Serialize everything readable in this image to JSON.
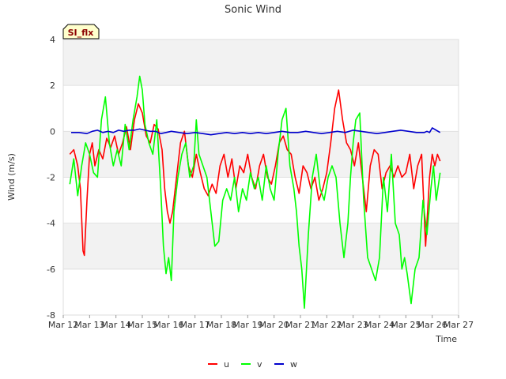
{
  "chart_data": {
    "type": "line",
    "title": "Sonic Wind",
    "xlabel": "Time",
    "ylabel": "Wind (m/s)",
    "badge": "SI_flx",
    "ylim": [
      -8,
      4
    ],
    "yticks": [
      -8,
      -6,
      -4,
      -2,
      0,
      2,
      4
    ],
    "xlim": [
      12,
      27
    ],
    "xticks": [
      {
        "x": 12,
        "label": "Mar 12"
      },
      {
        "x": 13,
        "label": "Mar 13"
      },
      {
        "x": 14,
        "label": "Mar 14"
      },
      {
        "x": 15,
        "label": "Mar 15"
      },
      {
        "x": 16,
        "label": "Mar 16"
      },
      {
        "x": 17,
        "label": "Mar 17"
      },
      {
        "x": 18,
        "label": "Mar 18"
      },
      {
        "x": 19,
        "label": "Mar 19"
      },
      {
        "x": 20,
        "label": "Mar 20"
      },
      {
        "x": 21,
        "label": "Mar 21"
      },
      {
        "x": 22,
        "label": "Mar 22"
      },
      {
        "x": 23,
        "label": "Mar 23"
      },
      {
        "x": 24,
        "label": "Mar 24"
      },
      {
        "x": 25,
        "label": "Mar 25"
      },
      {
        "x": 26,
        "label": "Mar 26"
      },
      {
        "x": 27,
        "label": "Mar 27"
      }
    ],
    "grid": true,
    "legend_position": "bottom",
    "series": [
      {
        "name": "u",
        "color": "#ff0000",
        "x": [
          12.25,
          12.4,
          12.55,
          12.65,
          12.75,
          12.8,
          12.9,
          13.0,
          13.1,
          13.2,
          13.35,
          13.5,
          13.65,
          13.8,
          13.95,
          14.1,
          14.25,
          14.4,
          14.55,
          14.7,
          14.85,
          15.0,
          15.15,
          15.3,
          15.45,
          15.6,
          15.75,
          15.85,
          15.95,
          16.05,
          16.15,
          16.3,
          16.45,
          16.6,
          16.75,
          16.9,
          17.05,
          17.2,
          17.35,
          17.5,
          17.65,
          17.8,
          17.95,
          18.1,
          18.25,
          18.4,
          18.55,
          18.7,
          18.85,
          19.0,
          19.15,
          19.3,
          19.45,
          19.6,
          19.75,
          19.9,
          20.05,
          20.2,
          20.35,
          20.5,
          20.65,
          20.8,
          20.95,
          21.1,
          21.25,
          21.4,
          21.55,
          21.7,
          21.85,
          22.0,
          22.15,
          22.3,
          22.45,
          22.6,
          22.75,
          22.9,
          23.05,
          23.2,
          23.35,
          23.5,
          23.65,
          23.8,
          23.95,
          24.1,
          24.25,
          24.4,
          24.55,
          24.7,
          24.85,
          25.0,
          25.15,
          25.3,
          25.45,
          25.6,
          25.75,
          25.9,
          26.0,
          26.1,
          26.2,
          26.3
        ],
        "y": [
          -1.0,
          -0.8,
          -1.5,
          -2.5,
          -5.2,
          -5.4,
          -3.0,
          -1.0,
          -0.5,
          -1.5,
          -0.8,
          -1.2,
          -0.3,
          -0.7,
          -0.2,
          -1.0,
          -0.5,
          0.2,
          -0.8,
          0.5,
          1.2,
          0.8,
          -0.2,
          -0.5,
          0.3,
          0.1,
          -0.8,
          -2.5,
          -3.5,
          -4.0,
          -3.5,
          -2.0,
          -0.5,
          0.0,
          -1.5,
          -2.0,
          -1.0,
          -1.8,
          -2.5,
          -2.8,
          -2.3,
          -2.7,
          -1.5,
          -1.0,
          -2.0,
          -1.2,
          -2.5,
          -1.5,
          -1.8,
          -1.0,
          -2.0,
          -2.5,
          -1.5,
          -1.0,
          -2.0,
          -2.3,
          -1.5,
          -0.5,
          -0.2,
          -0.8,
          -1.0,
          -2.0,
          -2.7,
          -1.5,
          -1.8,
          -2.5,
          -2.0,
          -3.0,
          -2.5,
          -1.8,
          -0.5,
          1.0,
          1.8,
          0.5,
          -0.5,
          -0.8,
          -1.5,
          -0.5,
          -2.0,
          -3.5,
          -1.5,
          -0.8,
          -1.0,
          -2.5,
          -1.8,
          -1.5,
          -2.0,
          -1.5,
          -2.0,
          -1.8,
          -1.0,
          -2.5,
          -1.5,
          -1.0,
          -5.0,
          -2.0,
          -1.0,
          -1.5,
          -1.0,
          -1.3
        ]
      },
      {
        "name": "v",
        "color": "#00ff00",
        "x": [
          12.25,
          12.4,
          12.55,
          12.7,
          12.85,
          13.0,
          13.15,
          13.3,
          13.45,
          13.6,
          13.75,
          13.9,
          14.05,
          14.2,
          14.35,
          14.5,
          14.65,
          14.8,
          14.9,
          15.0,
          15.1,
          15.25,
          15.4,
          15.55,
          15.7,
          15.8,
          15.9,
          16.0,
          16.1,
          16.2,
          16.35,
          16.5,
          16.65,
          16.8,
          16.95,
          17.05,
          17.15,
          17.3,
          17.45,
          17.6,
          17.75,
          17.9,
          18.05,
          18.2,
          18.35,
          18.5,
          18.65,
          18.8,
          18.95,
          19.1,
          19.25,
          19.4,
          19.55,
          19.7,
          19.85,
          20.0,
          20.15,
          20.3,
          20.45,
          20.6,
          20.75,
          20.85,
          20.95,
          21.05,
          21.15,
          21.3,
          21.45,
          21.6,
          21.75,
          21.9,
          22.05,
          22.2,
          22.35,
          22.5,
          22.65,
          22.8,
          22.9,
          23.0,
          23.1,
          23.25,
          23.4,
          23.55,
          23.7,
          23.85,
          24.0,
          24.15,
          24.3,
          24.45,
          24.6,
          24.75,
          24.85,
          24.95,
          25.05,
          25.2,
          25.35,
          25.5,
          25.65,
          25.8,
          25.95,
          26.05,
          26.15,
          26.3
        ],
        "y": [
          -2.3,
          -1.2,
          -2.8,
          -1.5,
          -0.5,
          -1.0,
          -1.8,
          -2.0,
          0.5,
          1.5,
          -0.5,
          -1.5,
          -0.8,
          -1.5,
          0.3,
          -0.8,
          0.5,
          1.5,
          2.4,
          1.8,
          0.3,
          -0.5,
          -1.0,
          0.5,
          -2.5,
          -5.0,
          -6.2,
          -5.5,
          -6.5,
          -3.5,
          -2.0,
          -1.0,
          -0.5,
          -2.0,
          -1.5,
          0.5,
          -1.0,
          -1.5,
          -2.0,
          -3.5,
          -5.0,
          -4.8,
          -3.0,
          -2.5,
          -3.0,
          -2.0,
          -3.5,
          -2.5,
          -3.0,
          -1.8,
          -2.5,
          -2.0,
          -3.0,
          -1.5,
          -2.5,
          -3.0,
          -1.0,
          0.5,
          1.0,
          -1.5,
          -2.5,
          -3.5,
          -5.0,
          -6.0,
          -7.7,
          -4.5,
          -2.0,
          -1.0,
          -2.5,
          -3.0,
          -2.0,
          -1.5,
          -2.0,
          -4.0,
          -5.5,
          -4.0,
          -2.0,
          -0.5,
          0.5,
          0.8,
          -3.0,
          -5.5,
          -6.0,
          -6.5,
          -5.5,
          -2.0,
          -3.5,
          -1.0,
          -4.0,
          -4.5,
          -6.0,
          -5.5,
          -6.2,
          -7.5,
          -6.0,
          -5.5,
          -3.0,
          -4.5,
          -2.5,
          -1.5,
          -3.0,
          -1.8
        ]
      },
      {
        "name": "w",
        "color": "#0000cc",
        "x": [
          12.3,
          12.6,
          12.9,
          13.1,
          13.3,
          13.5,
          13.7,
          13.9,
          14.1,
          14.3,
          14.5,
          14.7,
          14.9,
          15.1,
          15.3,
          15.5,
          15.7,
          15.9,
          16.1,
          16.4,
          16.7,
          17.0,
          17.3,
          17.6,
          17.9,
          18.2,
          18.5,
          18.8,
          19.1,
          19.4,
          19.7,
          20.0,
          20.3,
          20.6,
          20.9,
          21.2,
          21.5,
          21.8,
          22.1,
          22.4,
          22.7,
          23.0,
          23.3,
          23.6,
          23.9,
          24.2,
          24.5,
          24.8,
          25.1,
          25.4,
          25.7,
          25.8,
          25.9,
          26.0,
          26.3
        ],
        "y": [
          -0.05,
          -0.05,
          -0.1,
          0.0,
          0.05,
          -0.05,
          0.0,
          -0.05,
          0.05,
          0.0,
          0.05,
          0.05,
          0.1,
          0.05,
          0.0,
          0.0,
          -0.1,
          -0.05,
          0.0,
          -0.05,
          -0.1,
          -0.05,
          -0.1,
          -0.15,
          -0.1,
          -0.05,
          -0.1,
          -0.05,
          -0.1,
          -0.05,
          -0.1,
          -0.05,
          0.0,
          -0.05,
          -0.05,
          0.0,
          -0.05,
          -0.1,
          -0.05,
          0.0,
          -0.05,
          0.05,
          0.0,
          -0.05,
          -0.1,
          -0.05,
          0.0,
          0.05,
          0.0,
          -0.05,
          -0.05,
          0.0,
          -0.05,
          0.15,
          -0.05
        ]
      }
    ]
  }
}
